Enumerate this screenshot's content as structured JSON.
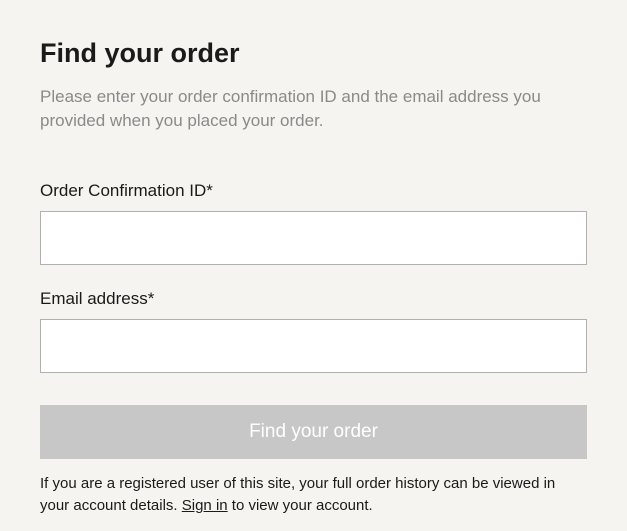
{
  "title": "Find your order",
  "description": "Please enter your order confirmation ID and the email address you provided when you placed your order.",
  "form": {
    "order_id": {
      "label": "Order Confirmation ID*",
      "value": ""
    },
    "email": {
      "label": "Email address*",
      "value": ""
    },
    "submit_label": "Find your order"
  },
  "footer": {
    "prefix": "If you are a registered user of this site, your full order history can be viewed in your account details. ",
    "signin_label": "Sign in",
    "suffix": " to view your account."
  }
}
